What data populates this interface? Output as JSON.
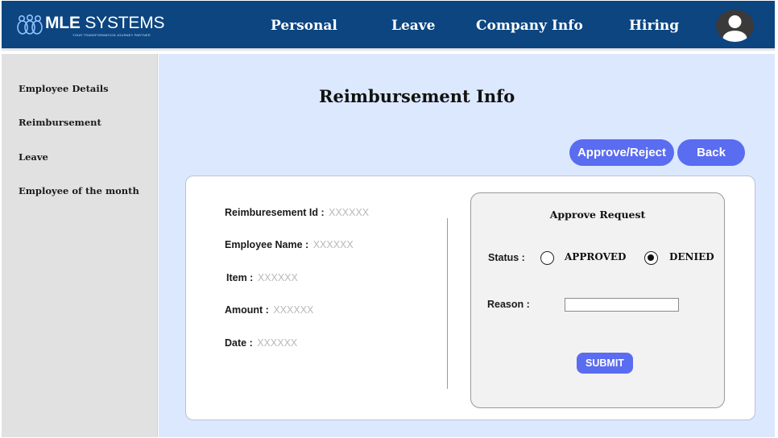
{
  "brand": {
    "name_bold": "MLE",
    "name_regular": " SYSTEMS",
    "tagline": "YOUR TRANSFORMATION JOURNEY PARTNER"
  },
  "nav": {
    "items": [
      {
        "label": "Personal"
      },
      {
        "label": "Leave"
      },
      {
        "label": "Company Info"
      },
      {
        "label": "Hiring"
      }
    ]
  },
  "sidebar": {
    "items": [
      {
        "label": "Employee Details"
      },
      {
        "label": "Reimbursement"
      },
      {
        "label": "Leave"
      },
      {
        "label": "Employee of the month"
      }
    ]
  },
  "main": {
    "title": "Reimbursement Info",
    "approve_reject_label": "Approve/Reject",
    "back_label": "Back"
  },
  "details": {
    "fields": [
      {
        "label": "Reimburesement Id :",
        "value": "XXXXXX"
      },
      {
        "label": "Employee Name :",
        "value": "XXXXXX"
      },
      {
        "label": "Item :",
        "value": "XXXXXX"
      },
      {
        "label": "Amount :",
        "value": "XXXXXX"
      },
      {
        "label": "Date :",
        "value": "XXXXXX"
      }
    ]
  },
  "approve": {
    "title": "Approve Request",
    "status_label": "Status :",
    "option_approved": "APPROVED",
    "option_denied": "DENIED",
    "selected": "DENIED",
    "reason_label": "Reason :",
    "reason_value": "",
    "submit_label": "SUBMIT"
  },
  "colors": {
    "header": "#0c4580",
    "sidebar": "#e1e1e1",
    "main_bg": "#dbe8fd",
    "accent_button": "#5a6cf0"
  },
  "icons": {
    "logo": "people-circles-logo",
    "avatar": "user-avatar-icon"
  }
}
